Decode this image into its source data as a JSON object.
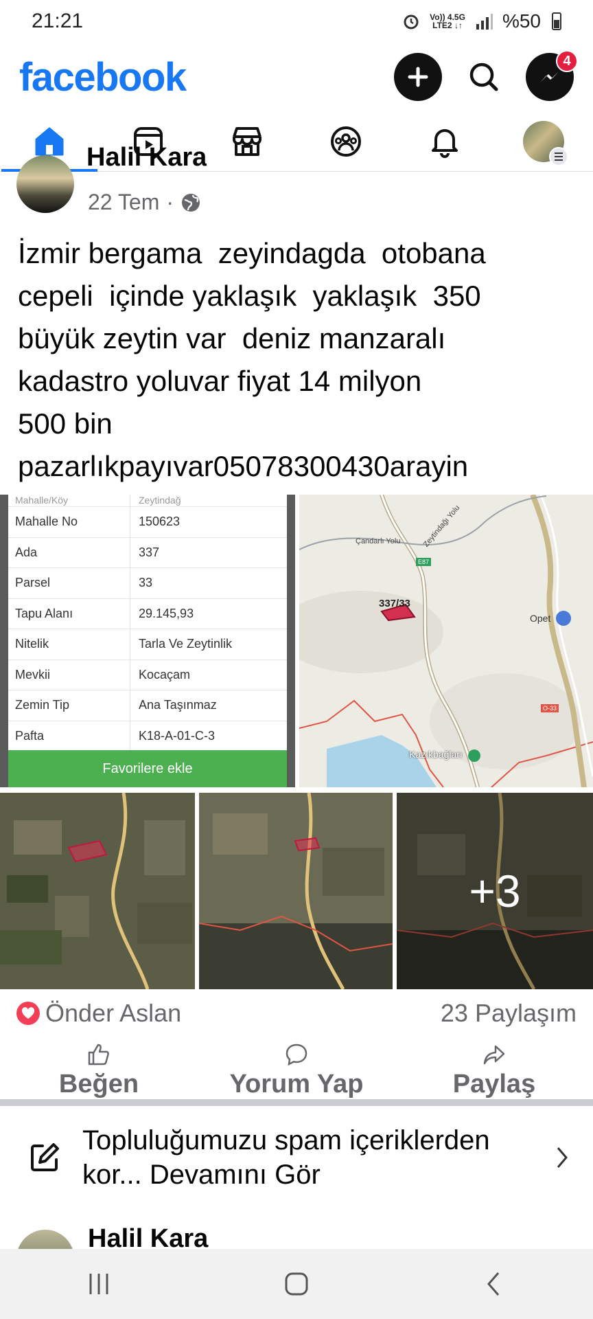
{
  "status_bar": {
    "time": "21:21",
    "net_top": "Vo)) 4.5G",
    "net_bottom": "LTE2 ↓↑",
    "battery": "%50"
  },
  "header": {
    "logo": "facebook",
    "messenger_badge": "4",
    "icons": [
      "plus-icon",
      "search-icon",
      "messenger-icon"
    ]
  },
  "tabs": [
    {
      "name": "home",
      "active": true
    },
    {
      "name": "video",
      "active": false
    },
    {
      "name": "marketplace",
      "active": false
    },
    {
      "name": "groups",
      "active": false
    },
    {
      "name": "notifications",
      "active": false
    },
    {
      "name": "profile-menu",
      "active": false
    }
  ],
  "post": {
    "author": "Halil Kara",
    "date": "22 Tem",
    "privacy_separator": "·",
    "text": "İzmir bergama  zeyindagda  otobana\ncepeli  içinde yaklaşık  yaklaşık  350\nbüyük zeytin var  deniz manzaralı\nkadastro yoluvar fiyat 14 milyon\n500 bin\npazarlıkpayıvar05078300430arayin",
    "table": {
      "top_cut": [
        "Mahalle/Köy",
        "Zeytindağ"
      ],
      "rows": [
        {
          "k": "Mahalle No",
          "v": "150623"
        },
        {
          "k": "Ada",
          "v": "337"
        },
        {
          "k": "Parsel",
          "v": "33"
        },
        {
          "k": "Tapu Alanı",
          "v": "29.145,93"
        },
        {
          "k": "Nitelik",
          "v": "Tarla Ve Zeytinlik"
        },
        {
          "k": "Mevkii",
          "v": "Kocaçam"
        },
        {
          "k": "Zemin Tip",
          "v": "Ana Taşınmaz"
        },
        {
          "k": "Pafta",
          "v": "K18-A-01-C-3"
        }
      ],
      "button": "Favorilere ekle"
    },
    "map": {
      "parcel_label": "337/33",
      "road1": "Çandarlı Yolu",
      "road2": "Zeytindağı Yolu",
      "highway": "E87",
      "o33": "O-33",
      "opet": "Opet",
      "village": "Kazıkbağları"
    },
    "more_photos": "+3",
    "reaction_name": "Önder Aslan",
    "shares": "23 Paylaşım",
    "actions": {
      "like": "Beğen",
      "comment": "Yorum Yap",
      "share": "Paylaş"
    }
  },
  "notice": {
    "text": "Topluluğumuzu spam içeriklerden kor... Devamını Gör"
  },
  "next_post": {
    "author": "Halil Kara"
  }
}
